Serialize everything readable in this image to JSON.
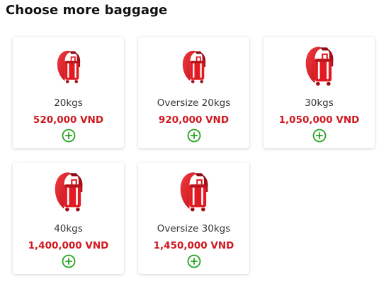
{
  "page": {
    "title": "Choose more baggage"
  },
  "colors": {
    "price": "#d0191f",
    "add_icon": "#22a31f",
    "bag_primary": "#e21b23",
    "bag_dark": "#a30f16"
  },
  "baggage_options": [
    {
      "label": "20kgs",
      "price": "520,000 VND",
      "icon": "suitcase-icon",
      "action_icon": "add-circle-icon"
    },
    {
      "label": "Oversize 20kgs",
      "price": "920,000 VND",
      "icon": "suitcase-icon",
      "action_icon": "add-circle-icon"
    },
    {
      "label": "30kgs",
      "price": "1,050,000 VND",
      "icon": "suitcase-icon",
      "action_icon": "add-circle-icon"
    },
    {
      "label": "40kgs",
      "price": "1,400,000 VND",
      "icon": "suitcase-icon",
      "action_icon": "add-circle-icon"
    },
    {
      "label": "Oversize 30kgs",
      "price": "1,450,000 VND",
      "icon": "suitcase-icon",
      "action_icon": "add-circle-icon"
    }
  ]
}
